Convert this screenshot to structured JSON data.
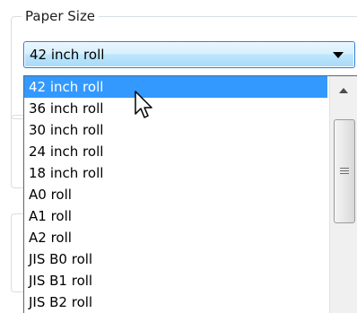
{
  "group": {
    "title": "Paper Size"
  },
  "combo": {
    "selected_value": "42 inch roll"
  },
  "dropdown": {
    "options": [
      "42 inch roll",
      "36 inch roll",
      "30 inch roll",
      "24 inch roll",
      "18 inch roll",
      "A0 roll",
      "A1 roll",
      "A2 roll",
      "JIS B0 roll",
      "JIS B1 roll",
      "JIS B2 roll"
    ],
    "highlighted_index": 0
  },
  "colors": {
    "highlight": "#3399ff",
    "combo_border": "#2b7bd9"
  },
  "icons": {
    "combo_arrow": "chevron-down-icon",
    "scroll_up": "scroll-up-arrow-icon",
    "cursor": "mouse-pointer-icon"
  }
}
